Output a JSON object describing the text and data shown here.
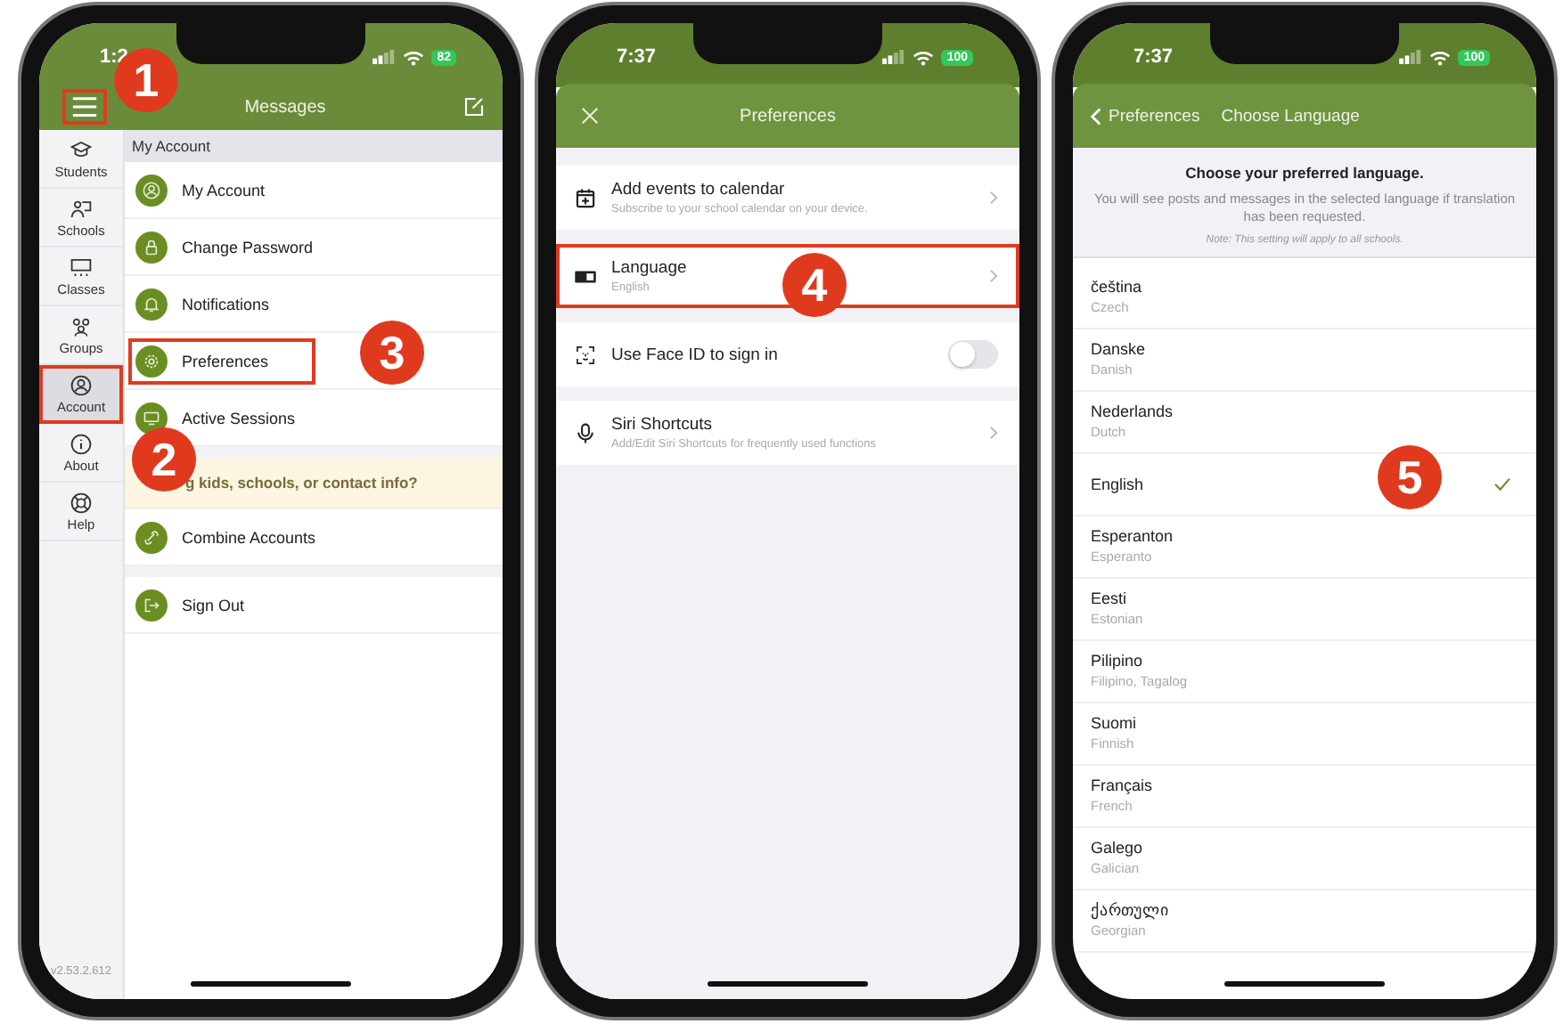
{
  "phones": [
    {
      "kind": "menu",
      "status": {
        "time": "1:2",
        "battery": "82"
      },
      "title": "Messages",
      "menu_button": {
        "highlighted": true
      },
      "sidebar": [
        {
          "label": "Students",
          "selected": false,
          "highlighted": false
        },
        {
          "label": "Schools",
          "selected": false,
          "highlighted": false
        },
        {
          "label": "Classes",
          "selected": false,
          "highlighted": false
        },
        {
          "label": "Groups",
          "selected": false,
          "highlighted": false
        },
        {
          "label": "Account",
          "selected": true,
          "highlighted": true
        },
        {
          "label": "About",
          "selected": false,
          "highlighted": false
        },
        {
          "label": "Help",
          "selected": false,
          "highlighted": false
        }
      ],
      "version": "v2.53.2.612",
      "section": "My Account",
      "items": [
        {
          "label": "My Account",
          "highlighted": false
        },
        {
          "label": "Change Password",
          "highlighted": false
        },
        {
          "label": "Notifications",
          "highlighted": false
        },
        {
          "label": "Preferences",
          "highlighted": true
        },
        {
          "label": "Active Sessions",
          "highlighted": false
        }
      ],
      "banner": "g kids, schools, or contact info?",
      "extra_items": [
        {
          "label": "Combine Accounts"
        },
        {
          "label": "Sign Out"
        }
      ],
      "steps": [
        {
          "number": "1"
        },
        {
          "number": "2"
        },
        {
          "number": "3"
        }
      ]
    },
    {
      "kind": "settings",
      "status": {
        "time": "7:37",
        "battery": "100"
      },
      "title": "Preferences",
      "rows": [
        {
          "kind": "link",
          "title": "Add events to calendar",
          "subtitle": "Subscribe to your school calendar on your device.",
          "highlighted": false
        },
        {
          "kind": "link",
          "title": "Language",
          "subtitle": "English",
          "highlighted": true
        },
        {
          "kind": "toggle",
          "title": "Use Face ID to sign in",
          "on": false,
          "highlighted": false
        },
        {
          "kind": "link",
          "title": "Siri Shortcuts",
          "subtitle": "Add/Edit Siri Shortcuts for frequently used functions",
          "highlighted": false
        }
      ],
      "steps": [
        {
          "number": "4"
        }
      ]
    },
    {
      "kind": "language",
      "status": {
        "time": "7:37",
        "battery": "100"
      },
      "back": "Preferences",
      "title": "Choose Language",
      "heading": "Choose your preferred language.",
      "description": "You will see posts and messages in the selected language if translation has been requested.",
      "note": "Note: This setting will apply to all schools.",
      "languages": [
        {
          "name": "čeština",
          "english": "Czech",
          "selected": false
        },
        {
          "name": "Danske",
          "english": "Danish",
          "selected": false
        },
        {
          "name": "Nederlands",
          "english": "Dutch",
          "selected": false
        },
        {
          "name": "English",
          "selected": true
        },
        {
          "name": "Esperanton",
          "english": "Esperanto",
          "selected": false
        },
        {
          "name": "Eesti",
          "english": "Estonian",
          "selected": false
        },
        {
          "name": "Pilipino",
          "english": "Filipino, Tagalog",
          "selected": false
        },
        {
          "name": "Suomi",
          "english": "Finnish",
          "selected": false
        },
        {
          "name": "Français",
          "english": "French",
          "selected": false
        },
        {
          "name": "Galego",
          "english": "Galician",
          "selected": false
        },
        {
          "name": "ქართული",
          "english": "Georgian",
          "selected": false
        }
      ],
      "steps": [
        {
          "number": "5"
        }
      ]
    }
  ]
}
